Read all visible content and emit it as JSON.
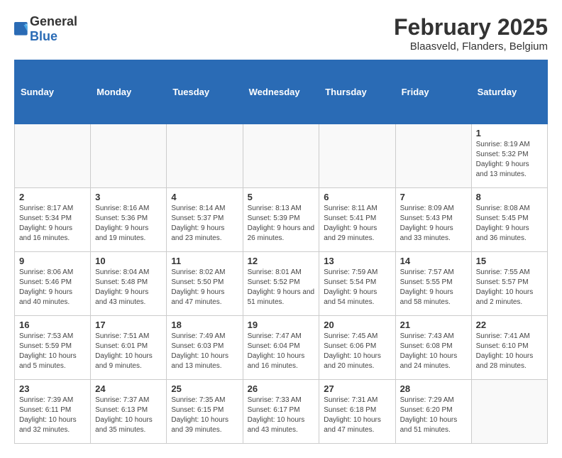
{
  "header": {
    "logo_general": "General",
    "logo_blue": "Blue",
    "month_title": "February 2025",
    "location": "Blaasveld, Flanders, Belgium"
  },
  "days_of_week": [
    "Sunday",
    "Monday",
    "Tuesday",
    "Wednesday",
    "Thursday",
    "Friday",
    "Saturday"
  ],
  "weeks": [
    [
      {
        "day": "",
        "info": ""
      },
      {
        "day": "",
        "info": ""
      },
      {
        "day": "",
        "info": ""
      },
      {
        "day": "",
        "info": ""
      },
      {
        "day": "",
        "info": ""
      },
      {
        "day": "",
        "info": ""
      },
      {
        "day": "1",
        "info": "Sunrise: 8:19 AM\nSunset: 5:32 PM\nDaylight: 9 hours and 13 minutes."
      }
    ],
    [
      {
        "day": "2",
        "info": "Sunrise: 8:17 AM\nSunset: 5:34 PM\nDaylight: 9 hours and 16 minutes."
      },
      {
        "day": "3",
        "info": "Sunrise: 8:16 AM\nSunset: 5:36 PM\nDaylight: 9 hours and 19 minutes."
      },
      {
        "day": "4",
        "info": "Sunrise: 8:14 AM\nSunset: 5:37 PM\nDaylight: 9 hours and 23 minutes."
      },
      {
        "day": "5",
        "info": "Sunrise: 8:13 AM\nSunset: 5:39 PM\nDaylight: 9 hours and 26 minutes."
      },
      {
        "day": "6",
        "info": "Sunrise: 8:11 AM\nSunset: 5:41 PM\nDaylight: 9 hours and 29 minutes."
      },
      {
        "day": "7",
        "info": "Sunrise: 8:09 AM\nSunset: 5:43 PM\nDaylight: 9 hours and 33 minutes."
      },
      {
        "day": "8",
        "info": "Sunrise: 8:08 AM\nSunset: 5:45 PM\nDaylight: 9 hours and 36 minutes."
      }
    ],
    [
      {
        "day": "9",
        "info": "Sunrise: 8:06 AM\nSunset: 5:46 PM\nDaylight: 9 hours and 40 minutes."
      },
      {
        "day": "10",
        "info": "Sunrise: 8:04 AM\nSunset: 5:48 PM\nDaylight: 9 hours and 43 minutes."
      },
      {
        "day": "11",
        "info": "Sunrise: 8:02 AM\nSunset: 5:50 PM\nDaylight: 9 hours and 47 minutes."
      },
      {
        "day": "12",
        "info": "Sunrise: 8:01 AM\nSunset: 5:52 PM\nDaylight: 9 hours and 51 minutes."
      },
      {
        "day": "13",
        "info": "Sunrise: 7:59 AM\nSunset: 5:54 PM\nDaylight: 9 hours and 54 minutes."
      },
      {
        "day": "14",
        "info": "Sunrise: 7:57 AM\nSunset: 5:55 PM\nDaylight: 9 hours and 58 minutes."
      },
      {
        "day": "15",
        "info": "Sunrise: 7:55 AM\nSunset: 5:57 PM\nDaylight: 10 hours and 2 minutes."
      }
    ],
    [
      {
        "day": "16",
        "info": "Sunrise: 7:53 AM\nSunset: 5:59 PM\nDaylight: 10 hours and 5 minutes."
      },
      {
        "day": "17",
        "info": "Sunrise: 7:51 AM\nSunset: 6:01 PM\nDaylight: 10 hours and 9 minutes."
      },
      {
        "day": "18",
        "info": "Sunrise: 7:49 AM\nSunset: 6:03 PM\nDaylight: 10 hours and 13 minutes."
      },
      {
        "day": "19",
        "info": "Sunrise: 7:47 AM\nSunset: 6:04 PM\nDaylight: 10 hours and 16 minutes."
      },
      {
        "day": "20",
        "info": "Sunrise: 7:45 AM\nSunset: 6:06 PM\nDaylight: 10 hours and 20 minutes."
      },
      {
        "day": "21",
        "info": "Sunrise: 7:43 AM\nSunset: 6:08 PM\nDaylight: 10 hours and 24 minutes."
      },
      {
        "day": "22",
        "info": "Sunrise: 7:41 AM\nSunset: 6:10 PM\nDaylight: 10 hours and 28 minutes."
      }
    ],
    [
      {
        "day": "23",
        "info": "Sunrise: 7:39 AM\nSunset: 6:11 PM\nDaylight: 10 hours and 32 minutes."
      },
      {
        "day": "24",
        "info": "Sunrise: 7:37 AM\nSunset: 6:13 PM\nDaylight: 10 hours and 35 minutes."
      },
      {
        "day": "25",
        "info": "Sunrise: 7:35 AM\nSunset: 6:15 PM\nDaylight: 10 hours and 39 minutes."
      },
      {
        "day": "26",
        "info": "Sunrise: 7:33 AM\nSunset: 6:17 PM\nDaylight: 10 hours and 43 minutes."
      },
      {
        "day": "27",
        "info": "Sunrise: 7:31 AM\nSunset: 6:18 PM\nDaylight: 10 hours and 47 minutes."
      },
      {
        "day": "28",
        "info": "Sunrise: 7:29 AM\nSunset: 6:20 PM\nDaylight: 10 hours and 51 minutes."
      },
      {
        "day": "",
        "info": ""
      }
    ]
  ]
}
